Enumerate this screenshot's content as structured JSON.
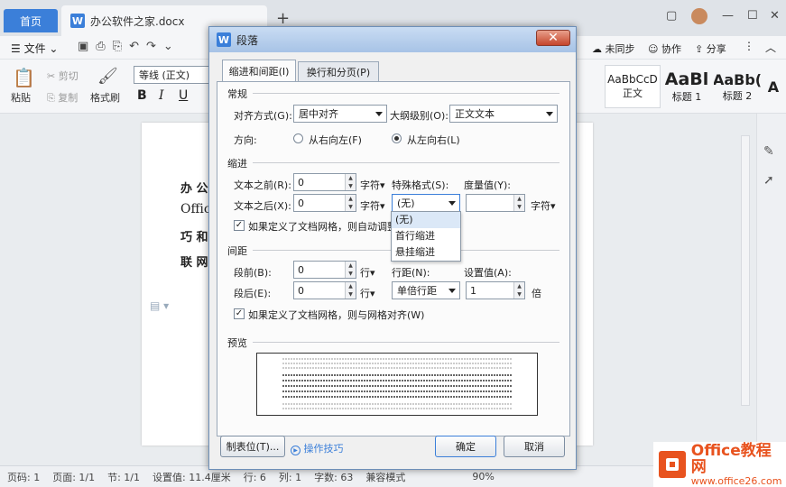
{
  "tabs": {
    "home": "首页",
    "doc": "办公软件之家.docx"
  },
  "menubar": {
    "file": "文件",
    "sync": "未同步",
    "collab": "协作",
    "share": "分享"
  },
  "toolbar": {
    "paste": "粘贴",
    "cut": "剪切",
    "copy": "复制",
    "format_painter": "格式刷",
    "font_name": "等线 (正文)",
    "bold": "B",
    "italic": "I",
    "underline": "U",
    "styles": [
      {
        "sample": "AaBbCcD",
        "label": "正文"
      },
      {
        "sample": "AaBl",
        "label": "标题 1"
      },
      {
        "sample": "AaBb(",
        "label": "标题 2"
      },
      {
        "sample": "A",
        "label": ""
      }
    ]
  },
  "document": {
    "lines": [
      "办 公",
      "Offic",
      "巧 和",
      "联 网"
    ]
  },
  "dialog": {
    "title": "段落",
    "tabs": [
      "缩进和间距(I)",
      "换行和分页(P)"
    ],
    "general": {
      "section": "常规",
      "alignment_label": "对齐方式(G):",
      "alignment_value": "居中对齐",
      "outline_label": "大纲级别(O):",
      "outline_value": "正文文本",
      "direction_label": "方向:",
      "rtl": "从右向左(F)",
      "ltr": "从左向右(L)"
    },
    "indent": {
      "section": "缩进",
      "before_label": "文本之前(R):",
      "before_value": "0",
      "before_unit": "字符▾",
      "after_label": "文本之后(X):",
      "after_value": "0",
      "after_unit": "字符▾",
      "special_label": "特殊格式(S):",
      "special_value": "(无)",
      "measure_label": "度量值(Y):",
      "measure_value": "",
      "measure_unit": "字符▾",
      "grid_check": "如果定义了文档网格，则自动调整",
      "dropdown_options": [
        "(无)",
        "首行缩进",
        "悬挂缩进"
      ]
    },
    "spacing": {
      "section": "间距",
      "before_label": "段前(B):",
      "before_value": "0",
      "before_unit": "行▾",
      "after_label": "段后(E):",
      "after_value": "0",
      "after_unit": "行▾",
      "line_label": "行距(N):",
      "line_value": "单倍行距",
      "setting_label": "设置值(A):",
      "setting_value": "1",
      "setting_unit": "倍",
      "grid_check": "如果定义了文档网格，则与网格对齐(W)"
    },
    "preview": {
      "section": "预览"
    },
    "buttons": {
      "tabs": "制表位(T)...",
      "tips": "操作技巧",
      "ok": "确定",
      "cancel": "取消"
    }
  },
  "status": {
    "items": [
      "页码: 1",
      "页面: 1/1",
      "节: 1/1",
      "设置值: 11.4厘米",
      "行: 6",
      "列: 1",
      "字数: 63",
      "兼容模式"
    ],
    "zoom": "90%"
  },
  "logo": {
    "name": "Office教程网",
    "url": "www.office26.com"
  },
  "colors": {
    "accent": "#3b7fd9",
    "logo": "#e8531f"
  }
}
